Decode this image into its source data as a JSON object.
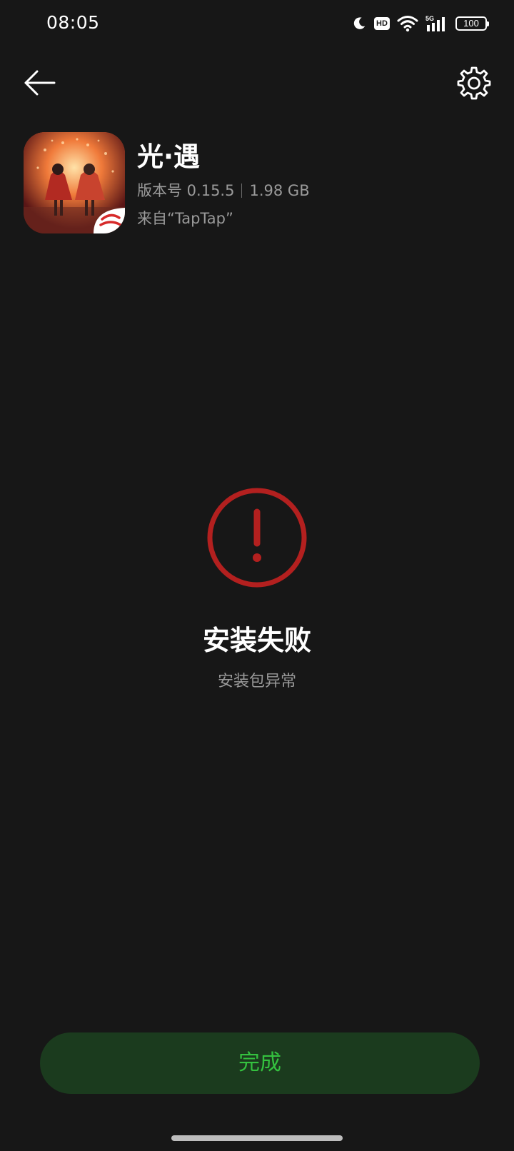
{
  "status_bar": {
    "time": "08:05",
    "hd_label": "HD",
    "network_label": "5G",
    "battery_level": "100"
  },
  "nav": {
    "back_icon": "arrow-left-icon",
    "settings_icon": "gear-icon"
  },
  "app": {
    "name": "光·遇",
    "version": "版本号 0.15.5",
    "size": "1.98 GB",
    "source": "来自“TapTap”",
    "icon": "sky-game-icon"
  },
  "result": {
    "icon": "exclamation-circle-icon",
    "title": "安装失败",
    "description": "安装包异常",
    "icon_color": "#b3201f"
  },
  "actions": {
    "done_label": "完成",
    "done_text_color": "#34c13f",
    "done_bg_color": "#1b3b1e"
  }
}
